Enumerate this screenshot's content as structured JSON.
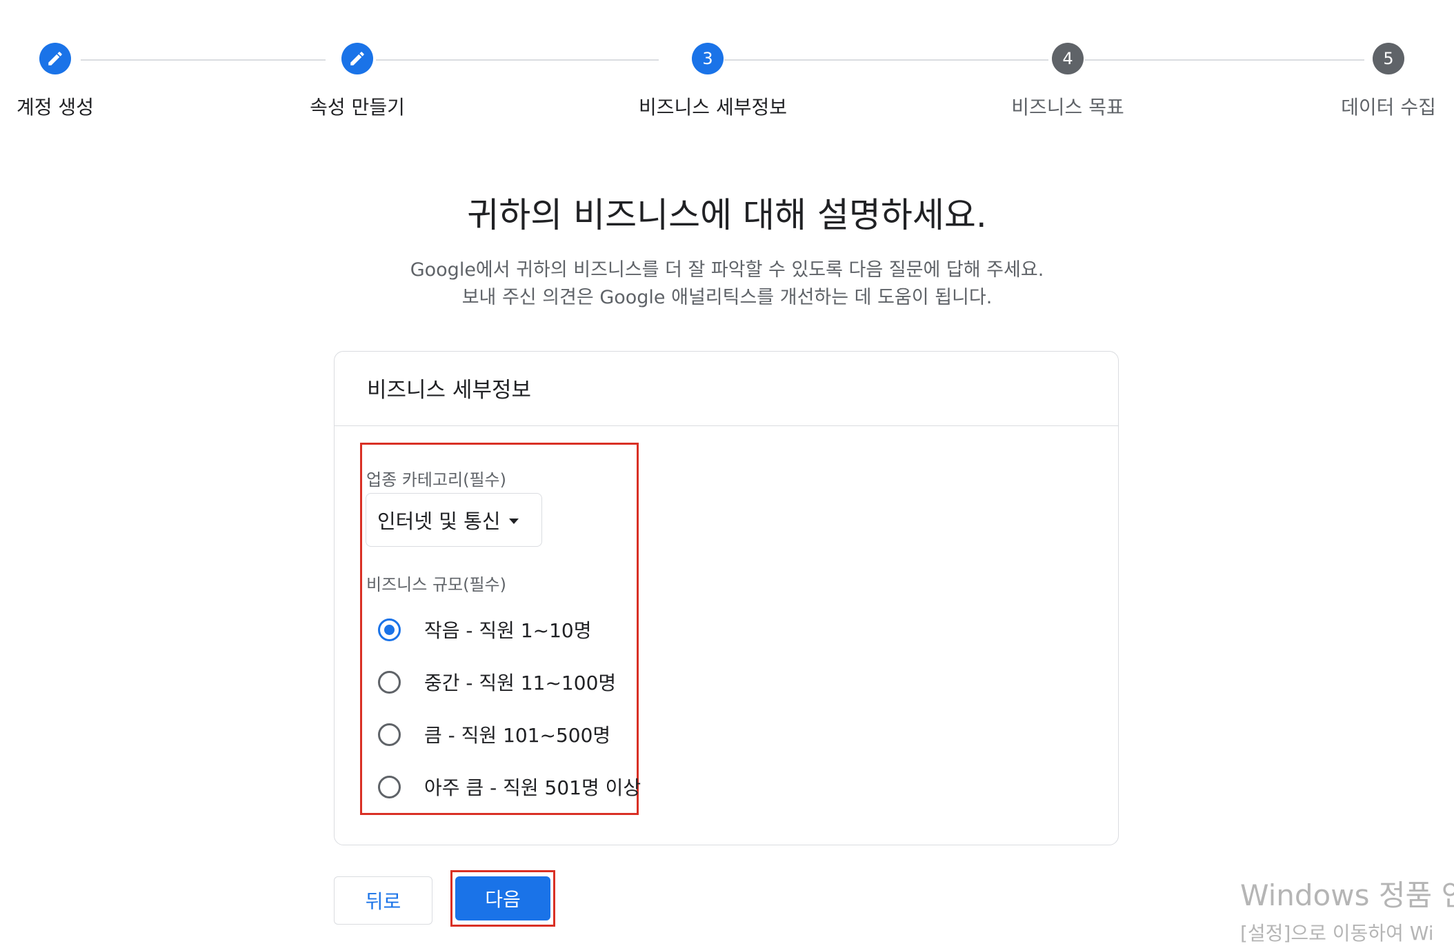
{
  "stepper": {
    "steps": [
      {
        "label": "계정 생성",
        "state": "done",
        "icon": "pencil-icon"
      },
      {
        "label": "속성 만들기",
        "state": "done",
        "icon": "pencil-icon"
      },
      {
        "label": "비즈니스 세부정보",
        "number": "3",
        "state": "active"
      },
      {
        "label": "비즈니스 목표",
        "number": "4",
        "state": "future"
      },
      {
        "label": "데이터 수집",
        "number": "5",
        "state": "future"
      }
    ]
  },
  "page": {
    "title": "귀하의 비즈니스에 대해 설명하세요.",
    "description_line1": "Google에서 귀하의 비즈니스를 더 잘 파악할 수 있도록 다음 질문에 답해 주세요.",
    "description_line2": "보내 주신 의견은 Google 애널리틱스를 개선하는 데 도움이 됩니다."
  },
  "card": {
    "title": "비즈니스 세부정보",
    "industry_label": "업종 카테고리(필수)",
    "industry_value": "인터넷 및 통신",
    "size_label": "비즈니스 규모(필수)",
    "size_options": [
      {
        "label": "작음 - 직원 1~10명",
        "checked": true
      },
      {
        "label": "중간 - 직원 11~100명",
        "checked": false
      },
      {
        "label": "큼 - 직원 101~500명",
        "checked": false
      },
      {
        "label": "아주 큼 - 직원 501명 이상",
        "checked": false
      }
    ]
  },
  "actions": {
    "back_label": "뒤로",
    "next_label": "다음"
  },
  "watermark": {
    "line1": "Windows 정품 인",
    "line2": "[설정]으로 이동하여 Wi"
  },
  "colors": {
    "accent": "#1a73e8",
    "highlight": "#d93025",
    "future_step": "#5f6368"
  }
}
